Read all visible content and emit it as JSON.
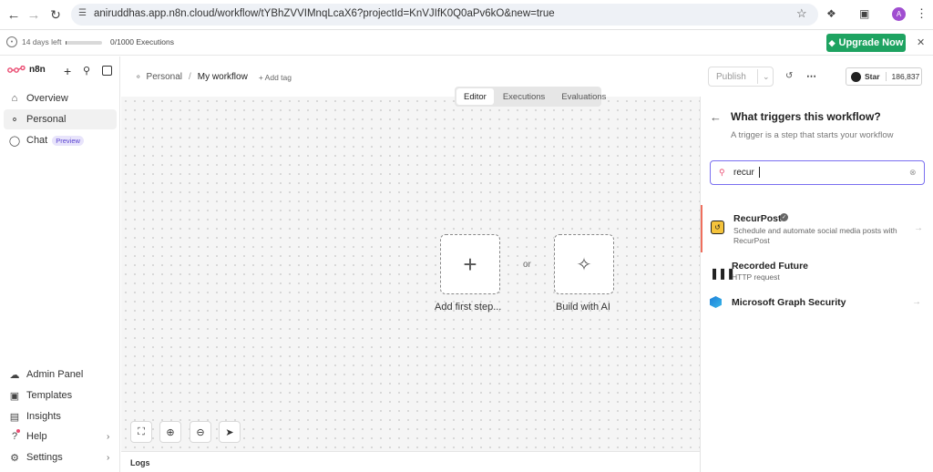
{
  "browser": {
    "url": "aniruddhas.app.n8n.cloud/workflow/tYBhZVVIMnqLcaX6?projectId=KnVJIfK0Q0aPv6kO&new=true",
    "avatar_letter": "A"
  },
  "trial": {
    "days_left": "14 days left",
    "progress_fraction": 0.03,
    "executions": "0/1000 Executions",
    "upgrade_label": "Upgrade Now"
  },
  "sidebar": {
    "logo": "n8n",
    "items": [
      {
        "label": "Overview",
        "icon": "home-icon"
      },
      {
        "label": "Personal",
        "icon": "user-icon"
      },
      {
        "label": "Chat",
        "icon": "chat-icon",
        "badge": "Preview"
      }
    ],
    "bottom_items": [
      {
        "label": "Admin Panel",
        "icon": "cloud-icon"
      },
      {
        "label": "Templates",
        "icon": "box-icon"
      },
      {
        "label": "Insights",
        "icon": "chart-icon"
      },
      {
        "label": "Help",
        "icon": "help-icon"
      },
      {
        "label": "Settings",
        "icon": "gear-icon"
      }
    ]
  },
  "header": {
    "breadcrumb_project": "Personal",
    "separator": "/",
    "workflow_name": "My workflow",
    "add_tag": "+ Add tag",
    "publish_label": "Publish",
    "star_label": "Star",
    "star_count": "186,837"
  },
  "tabs": [
    "Editor",
    "Executions",
    "Evaluations"
  ],
  "canvas": {
    "add_first_step": "Add first step...",
    "or": "or",
    "build_with_ai": "Build with AI",
    "logs_label": "Logs"
  },
  "panel": {
    "title": "What triggers this workflow?",
    "subtitle": "A trigger is a step that starts your workflow",
    "search_value": "recur",
    "results": [
      {
        "title": "RecurPost",
        "verified": true,
        "desc": "Schedule and automate social media posts with RecurPost",
        "icon": "recurpost-icon"
      },
      {
        "title": "Recorded Future",
        "desc": "HTTP request",
        "icon": "recorded-future-icon"
      },
      {
        "title": "Microsoft Graph Security",
        "desc": "",
        "icon": "ms-graph-icon"
      }
    ]
  },
  "colors": {
    "accent": "#7a6ff0",
    "upgrade": "#1ea361",
    "brand": "#ea4b71"
  }
}
